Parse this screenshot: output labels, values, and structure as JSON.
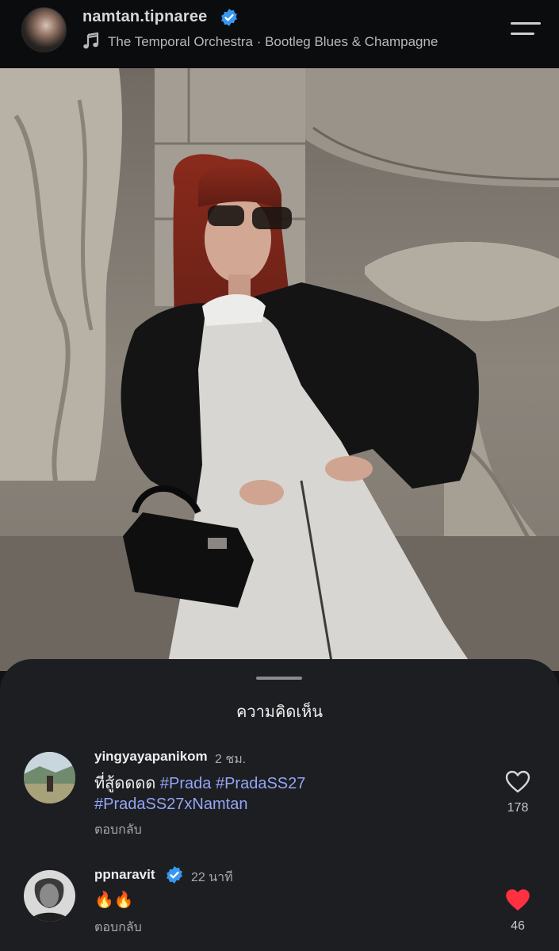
{
  "header": {
    "username": "namtan.tipnaree",
    "music": "The Temporal Orchestra · Bootleg Blues & Champagne"
  },
  "comments_sheet": {
    "title": "ความคิดเห็น",
    "comments": [
      {
        "username": "yingyayapanikom",
        "time": "2 ชม.",
        "text_plain": "ที่สู้ดดดด",
        "hashtags": [
          "#Prada",
          "#PradaSS27",
          "#PradaSS27xNamtan"
        ],
        "reply": "ตอบกลับ",
        "likes": "178",
        "liked": false,
        "verified": false
      },
      {
        "username": "ppnaravit",
        "time": "22 นาที",
        "text_plain": "🔥🔥",
        "reply": "ตอบกลับ",
        "likes": "46",
        "liked": true,
        "verified": true
      }
    ]
  },
  "colors": {
    "background": "#111214",
    "sheet": "#1d1e22",
    "hashtag": "#93a5f5",
    "verified": "#3897f0",
    "liked_heart": "#ff3040"
  }
}
